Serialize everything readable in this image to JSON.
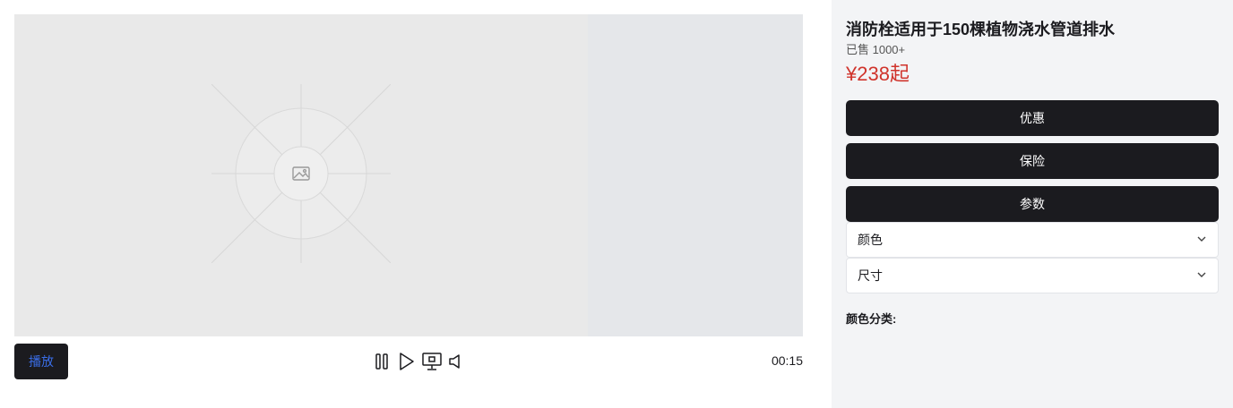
{
  "product": {
    "title": "消防栓适用于150棵植物浇水管道排水",
    "sold": "已售 1000+",
    "price": "¥238起"
  },
  "player": {
    "play_label": "播放",
    "time": "00:15",
    "icons": [
      "pause-icon",
      "play-icon",
      "screen-icon",
      "volume-icon"
    ]
  },
  "actions": {
    "discount": "优惠",
    "insurance": "保险",
    "params": "参数"
  },
  "selects": {
    "color": "颜色",
    "size": "尺寸"
  },
  "sections": {
    "color_category": "颜色分类:"
  },
  "colors": {
    "accent_blue": "#3a6ee8",
    "price_red": "#d0342c",
    "dark": "#1b1b1f"
  }
}
